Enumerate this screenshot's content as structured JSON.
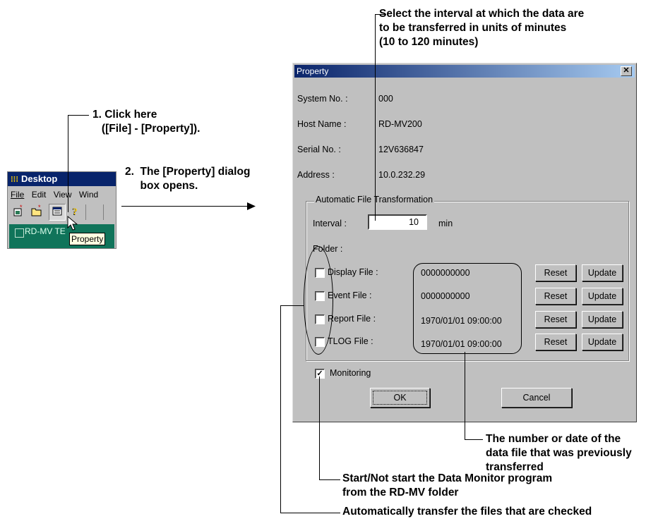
{
  "callouts": {
    "interval_note": "Select the interval at which the data are\nto be transferred in units of minutes\n(10 to 120 minutes)",
    "step1": "1. Click here\n   ([File] - [Property]).",
    "step2": "2.  The [Property] dialog\n     box opens.",
    "previous_file": "The number or date of the\ndata file that was previously\ntransferred",
    "monitoring_note": "Start/Not start the Data Monitor program\nfrom the RD-MV folder",
    "auto_transfer_note": "Automatically transfer the files that are checked"
  },
  "desktop_window": {
    "title": "Desktop",
    "menu": [
      "File",
      "Edit",
      "View",
      "Wind"
    ],
    "toolbar_icons": [
      "new-icon",
      "open-folder-icon",
      "property-icon",
      "help-icon"
    ],
    "item_label": "RD-MV TE",
    "tooltip": "Property"
  },
  "dialog": {
    "title": "Property",
    "close_glyph": "✕",
    "fields": [
      {
        "label": "System No. :",
        "value": "000"
      },
      {
        "label": "Host Name :",
        "value": "RD-MV200"
      },
      {
        "label": "Serial No. :",
        "value": "12V636847"
      },
      {
        "label": "Address :",
        "value": "10.0.232.29"
      }
    ],
    "group_title": "Automatic File Transformation",
    "interval_label": "Interval :",
    "interval_value": "10",
    "interval_unit": "min",
    "folder_label": "Folder :",
    "files": [
      {
        "label": "Display File :",
        "value": "0000000000",
        "checked": false
      },
      {
        "label": "Event File :",
        "value": "0000000000",
        "checked": false
      },
      {
        "label": "Report File :",
        "value": "1970/01/01 09:00:00",
        "checked": false
      },
      {
        "label": "TLOG File :",
        "value": "1970/01/01 09:00:00",
        "checked": false
      }
    ],
    "reset_label": "Reset",
    "update_label": "Update",
    "monitoring_label": "Monitoring",
    "monitoring_checked": true,
    "ok_label": "OK",
    "cancel_label": "Cancel"
  }
}
